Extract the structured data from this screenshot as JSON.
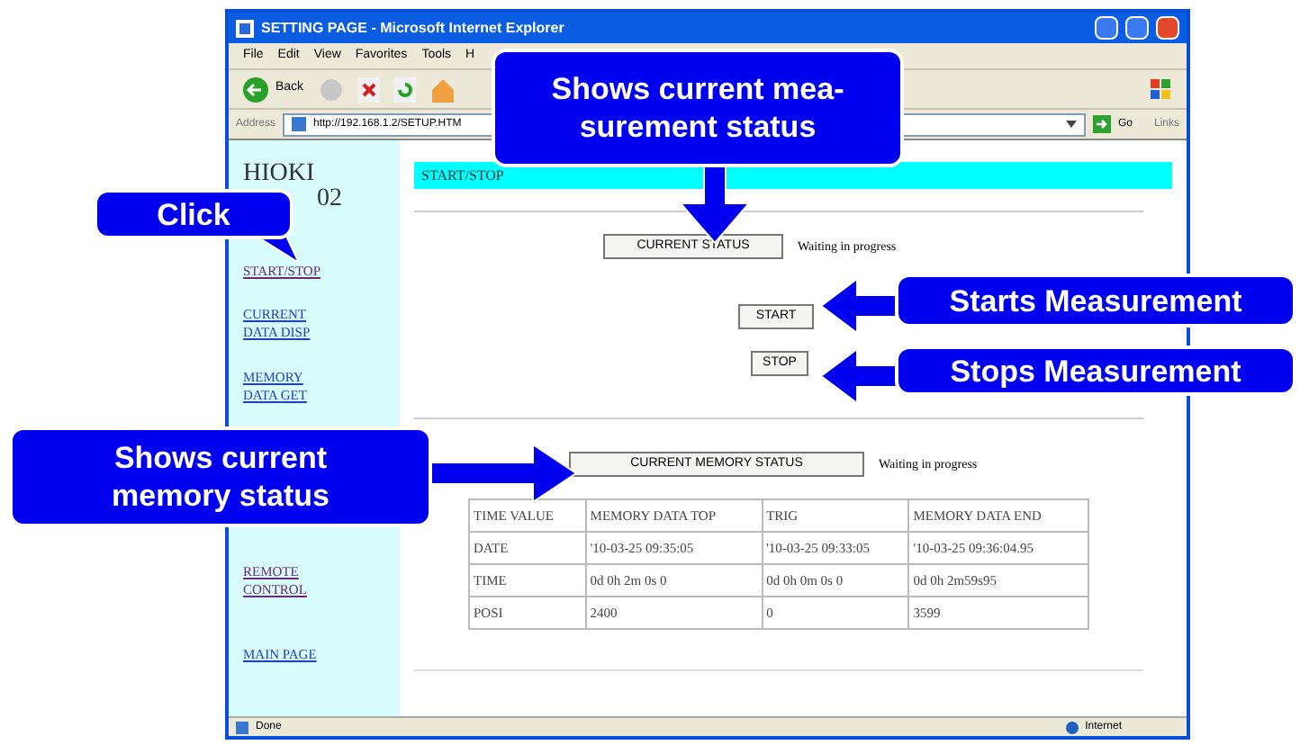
{
  "window": {
    "title": "SETTING PAGE - Microsoft Internet Explorer"
  },
  "menu": [
    "File",
    "Edit",
    "View",
    "Favorites",
    "Tools",
    "H"
  ],
  "toolbar": {
    "back": "Back"
  },
  "address_bar": {
    "label": "Address",
    "url": "http://192.168.1.2/SETUP.HTM",
    "go": "Go",
    "links": "Links"
  },
  "sidebar": {
    "title": [
      "HIOKI",
      "02"
    ],
    "links": [
      {
        "label": "START/STOP",
        "visited": true
      },
      {
        "label": "CURRENT DATA DISP",
        "visited": false
      },
      {
        "label": "MEMORY DATA GET",
        "visited": false
      },
      {
        "label": "REMOTE CONTROL",
        "visited": true
      },
      {
        "label": "MAIN PAGE",
        "visited": false
      }
    ]
  },
  "page": {
    "heading": "START/STOP",
    "current_status": {
      "button": "CURRENT STATUS",
      "status": "Waiting in progress"
    },
    "start_button": "START",
    "stop_button": "STOP",
    "memory_status": {
      "button": "CURRENT MEMORY STATUS",
      "status": "Waiting in progress"
    },
    "table": {
      "columns": [
        "TIME VALUE",
        "MEMORY DATA TOP",
        "TRIG",
        "MEMORY DATA END"
      ],
      "rows": [
        [
          "DATE",
          "'10-03-25 09:35:05",
          "'10-03-25 09:33:05",
          "'10-03-25 09:36:04.95"
        ],
        [
          "TIME",
          "0d 0h 2m 0s 0",
          "0d 0h 0m 0s 0",
          "0d 0h 2m59s95"
        ],
        [
          "POSI",
          "2400",
          "0",
          "3599"
        ]
      ]
    }
  },
  "status_bar": {
    "text": "Done",
    "zone": "Internet"
  },
  "callouts": [
    {
      "kind": "down",
      "lines": [
        "Shows current mea-",
        "surement status"
      ]
    },
    {
      "kind": "tail",
      "lines": [
        "Click"
      ]
    },
    {
      "kind": "left",
      "lines": [
        "Starts Measurement"
      ]
    },
    {
      "kind": "left",
      "lines": [
        "Stops Measurement"
      ]
    },
    {
      "kind": "right",
      "lines": [
        "Shows current",
        "memory status"
      ]
    }
  ]
}
